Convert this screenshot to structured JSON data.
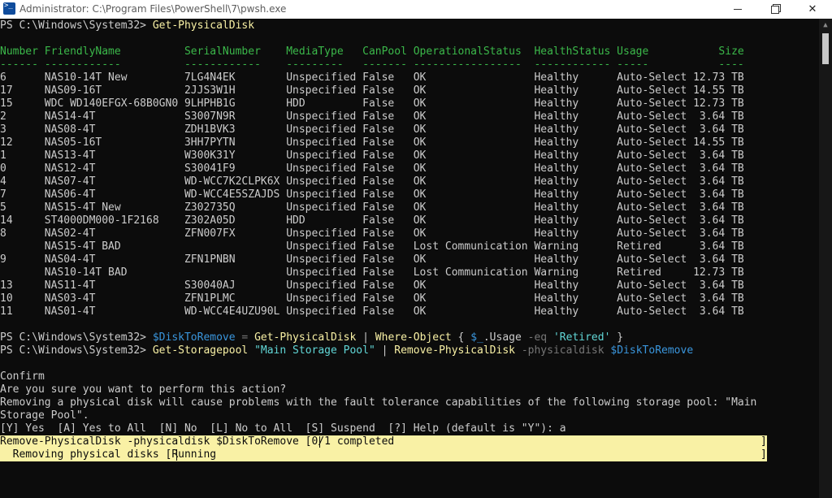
{
  "window": {
    "title": "Administrator: C:\\Program Files\\PowerShell\\7\\pwsh.exe",
    "icon": "powershell-icon",
    "controls": [
      "minimize-icon",
      "maximize-icon",
      "close-icon"
    ]
  },
  "console": {
    "prompt": "PS C:\\Windows\\System32> ",
    "cmd1": "Get-PhysicalDisk",
    "columns": [
      "Number",
      "FriendlyName",
      "SerialNumber",
      "MediaType",
      "CanPool",
      "OperationalStatus",
      "HealthStatus",
      "Usage",
      "Size"
    ],
    "header_line": "Number FriendlyName          SerialNumber    MediaType   CanPool OperationalStatus  HealthStatus Usage           Size",
    "underline_line": "------ ------------          ------------    ---------   ------- -----------------  ------------ -----           ----",
    "rows": [
      "6      NAS10-14T New         7LG4N4EK        Unspecified False   OK                 Healthy      Auto-Select 12.73 TB",
      "17     NAS09-16T             2JJS3W1H        Unspecified False   OK                 Healthy      Auto-Select 14.55 TB",
      "15     WDC WD140EFGX-68B0GN0 9LHPHB1G        HDD         False   OK                 Healthy      Auto-Select 12.73 TB",
      "2      NAS14-4T              S3007N9R        Unspecified False   OK                 Healthy      Auto-Select  3.64 TB",
      "3      NAS08-4T              ZDH1BVK3        Unspecified False   OK                 Healthy      Auto-Select  3.64 TB",
      "12     NAS05-16T             3HH7PYTN        Unspecified False   OK                 Healthy      Auto-Select 14.55 TB",
      "1      NAS13-4T              W300K31Y        Unspecified False   OK                 Healthy      Auto-Select  3.64 TB",
      "0      NAS12-4T              S30041F9        Unspecified False   OK                 Healthy      Auto-Select  3.64 TB",
      "4      NAS07-4T              WD-WCC7K2CLPK6X Unspecified False   OK                 Healthy      Auto-Select  3.64 TB",
      "7      NAS06-4T              WD-WCC4E5SZAJDS Unspecified False   OK                 Healthy      Auto-Select  3.64 TB",
      "5      NAS15-4T New          Z302735Q        Unspecified False   OK                 Healthy      Auto-Select  3.64 TB",
      "14     ST4000DM000-1F2168    Z302A05D        HDD         False   OK                 Healthy      Auto-Select  3.64 TB",
      "8      NAS02-4T              ZFN007FX        Unspecified False   OK                 Healthy      Auto-Select  3.64 TB",
      "       NAS15-4T BAD                          Unspecified False   Lost Communication Warning      Retired      3.64 TB",
      "9      NAS04-4T              ZFN1PNBN        Unspecified False   OK                 Healthy      Auto-Select  3.64 TB",
      "       NAS10-14T BAD                         Unspecified False   Lost Communication Warning      Retired     12.73 TB",
      "13     NAS11-4T              S30040AJ        Unspecified False   OK                 Healthy      Auto-Select  3.64 TB",
      "10     NAS03-4T              ZFN1PLMC        Unspecified False   OK                 Healthy      Auto-Select  3.64 TB",
      "11     NAS01-4T              WD-WCC4E4UZU90L Unspecified False   OK                 Healthy      Auto-Select  3.64 TB"
    ],
    "cmd2": {
      "var": "$DiskToRemove",
      "eq": " = ",
      "cmd": "Get-PhysicalDisk",
      "pipe": " | ",
      "where": "Where-Object",
      "open": " { ",
      "us": "$_",
      "prop": ".Usage ",
      "op": "-eq",
      "str": " 'Retired'",
      "close": " }"
    },
    "cmd3": {
      "cmd": "Get-Storagepool",
      "str": " \"Main Storage Pool\"",
      "pipe": " | ",
      "cmd2": "Remove-PhysicalDisk",
      "param": " -physicaldisk",
      "var": " $DiskToRemove"
    },
    "confirm_title": "Confirm",
    "confirm_question": "Are you sure you want to perform this action?",
    "confirm_msg1": "Removing a physical disk will cause problems with the fault tolerance capabilities of the following storage pool: \"Main",
    "confirm_msg2": "Storage Pool\".",
    "confirm_options": "[Y] Yes  [A] Yes to All  [N] No  [L] No to All  [S] Suspend  [?] Help (default is \"Y\"): a",
    "progress_line1_prefix": "Remove-PhysicalDisk -physicaldisk $DiskToRemove [",
    "progress_status1": "0/1 completed",
    "progress_line2_prefix": "  Removing physical disks [",
    "progress_status2": "Running",
    "progress_end": "]"
  },
  "colors": {
    "background": "#0c0c0c",
    "text": "#cccccc",
    "header": "#3bb84a",
    "command": "#f9f1a5",
    "variable": "#3a96dd",
    "string": "#61d6d6",
    "parameter": "#767676",
    "progress_bg": "#f9f1a5"
  }
}
